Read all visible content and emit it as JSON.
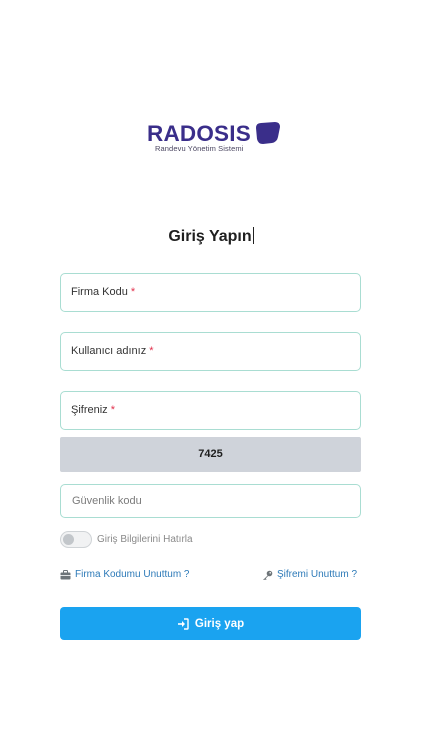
{
  "logo": {
    "brand": "RADOSIS",
    "tagline": "Randevu Yönetim Sistemi",
    "brand_color": "#3a2e8a"
  },
  "title": "Giriş Yapın",
  "fields": {
    "company_code": {
      "label": "Firma Kodu",
      "required_mark": "*"
    },
    "username": {
      "label": "Kullanıcı adınız",
      "required_mark": "*"
    },
    "password": {
      "label": "Şifreniz",
      "required_mark": "*"
    }
  },
  "captcha": {
    "code": "7425"
  },
  "security": {
    "placeholder": "Güvenlik kodu"
  },
  "remember": {
    "label": "Giriş Bilgilerini Hatırla",
    "checked": false
  },
  "links": {
    "forgot_company": "Firma Kodumu Unuttum ?",
    "forgot_password": "Şifremi Unuttum ?"
  },
  "submit": {
    "label": "Giriş yap"
  },
  "colors": {
    "accent": "#1aa3f0",
    "link": "#2d7ab8",
    "required": "#e2304c",
    "border": "#a9ddd2"
  },
  "icons": {
    "company_link": "briefcase-icon",
    "password_link": "key-icon",
    "submit": "sign-in-icon"
  }
}
